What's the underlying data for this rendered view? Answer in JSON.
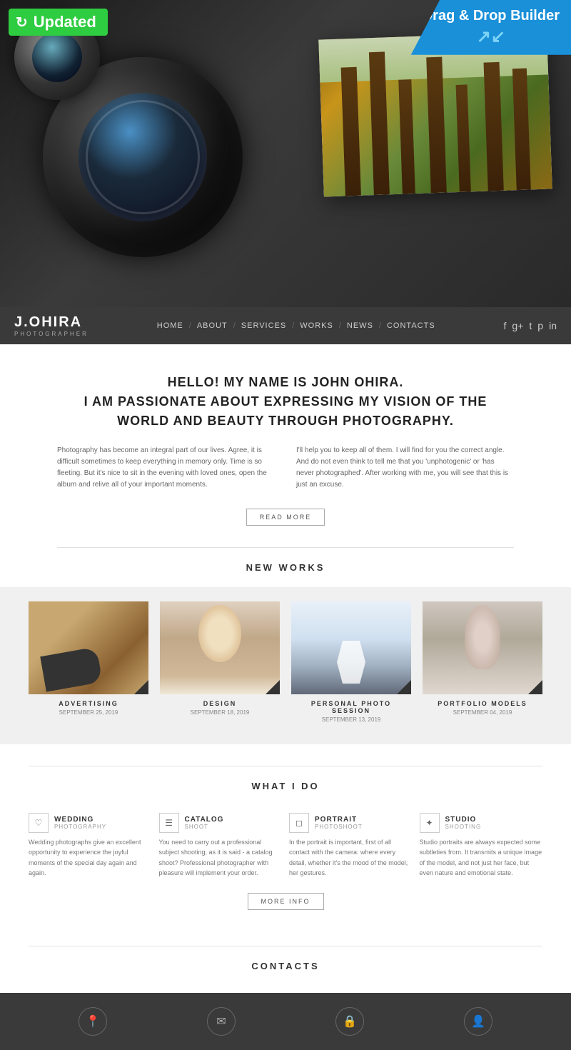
{
  "badges": {
    "updated_label": "Updated",
    "dnd_line1": "Drag & Drop",
    "dnd_line2": "Builder"
  },
  "navbar": {
    "brand": "J.OHIRA",
    "brand_sub": "PHOTOGRAPHER",
    "nav_items": [
      {
        "label": "HOME"
      },
      {
        "label": "ABOUT"
      },
      {
        "label": "SERVICES"
      },
      {
        "label": "WORKS"
      },
      {
        "label": "NEWS"
      },
      {
        "label": "CONTACTS"
      }
    ],
    "social": [
      "f",
      "g+",
      "t",
      "p",
      "in"
    ]
  },
  "about": {
    "title_line1": "HELLO! MY NAME IS JOHN OHIRA.",
    "title_line2": "I AM PASSIONATE ABOUT EXPRESSING MY VISION OF THE",
    "title_line3": "WORLD AND BEAUTY THROUGH PHOTOGRAPHY.",
    "col1": "Photography has become an integral part of our lives. Agree, it is difficult sometimes to keep everything in memory only. Time is so fleeting. But it's nice to sit in the evening with loved ones, open the album and relive all of your important moments.",
    "col2": "I'll help you to keep all of them. I will find for you the correct angle. And do not even think to tell me that you 'unphotogenic' or 'has never photographed'. After working with me, you will see that this is just an excuse.",
    "read_more": "READ MORE"
  },
  "new_works": {
    "section_title": "NEW WORKS",
    "items": [
      {
        "label": "ADVERTISING",
        "date": "SEPTEMBER 25, 2019",
        "thumb_class": "thumb-advertising"
      },
      {
        "label": "DESIGN",
        "date": "SEPTEMBER 18, 2019",
        "thumb_class": "thumb-design"
      },
      {
        "label": "PERSONAL PHOTO SESSION",
        "date": "SEPTEMBER 13, 2019",
        "thumb_class": "thumb-cycling"
      },
      {
        "label": "PORTFOLIO MODELS",
        "date": "SEPTEMBER 04, 2019",
        "thumb_class": "thumb-models"
      }
    ]
  },
  "what_i_do": {
    "section_title": "WHAT I DO",
    "services": [
      {
        "name": "WEDDING",
        "sub": "PHOTOGRAPHY",
        "icon": "♡",
        "desc": "Wedding photographs give an excellent opportunity to experience the joyful moments of the special day again and again."
      },
      {
        "name": "CATALOG",
        "sub": "SHOOT",
        "icon": "☰",
        "desc": "You need to carry out a professional subject shooting, as it is said - a catalog shoot? Professional photographer with pleasure will implement your order."
      },
      {
        "name": "PORTRAIT",
        "sub": "PHOTOSHOOT",
        "icon": "◻",
        "desc": "In the portrait is important, first of all contact with the camera: where every detail, whether it's the mood of the model, her gestures."
      },
      {
        "name": "STUDIO",
        "sub": "SHOOTING",
        "icon": "✦",
        "desc": "Studio portraits are always expected some subtleties from. It transmits a unique image of the model, and not just her face, but even nature and emotional state."
      }
    ],
    "more_info": "MORE INFO"
  },
  "contacts": {
    "section_title": "CONTACTS",
    "footer_icons": [
      "📍",
      "✉",
      "🔒",
      "👤"
    ]
  }
}
